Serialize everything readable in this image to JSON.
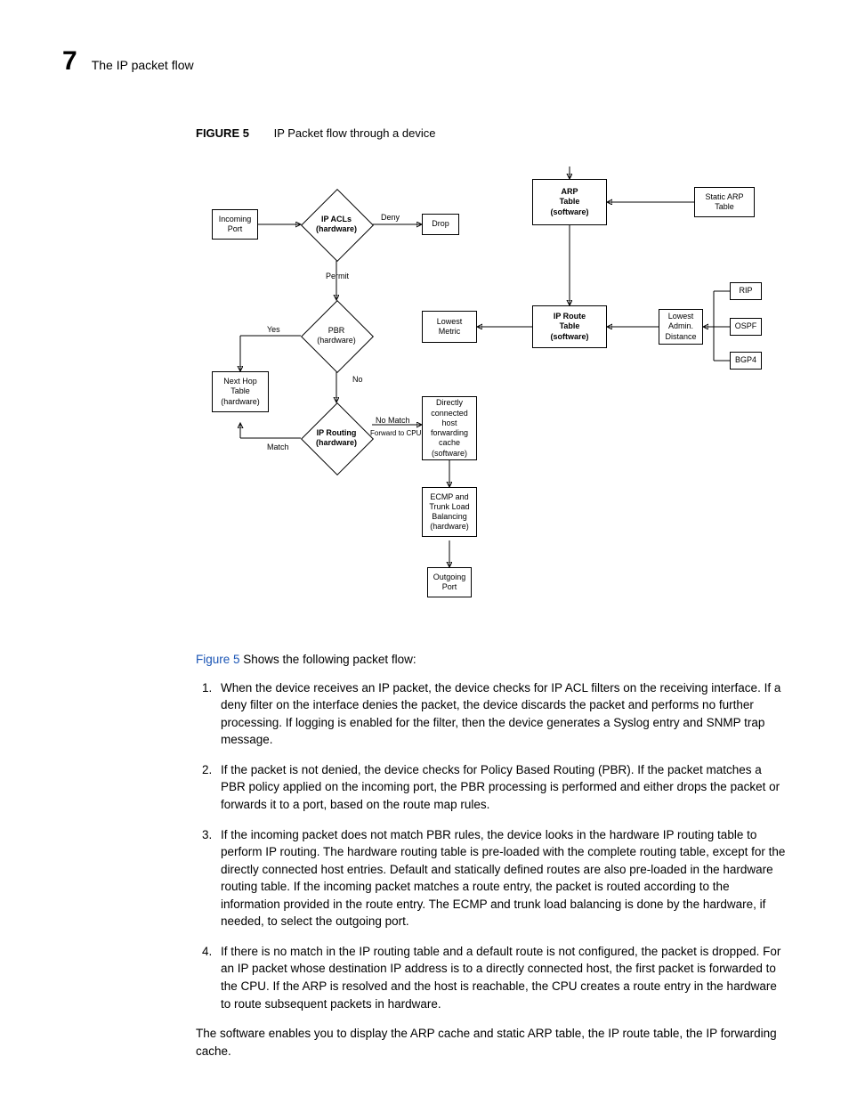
{
  "header": {
    "chapter_number": "7",
    "chapter_title": "The IP packet flow"
  },
  "figure": {
    "label": "FIGURE 5",
    "title": "IP Packet flow through a device"
  },
  "flow": {
    "incoming_port": "Incoming\nPort",
    "ip_acls": "IP ACLs\n(hardware)",
    "deny": "Deny",
    "drop": "Drop",
    "permit": "Permit",
    "pbr": "PBR\n(hardware)",
    "yes": "Yes",
    "no": "No",
    "next_hop": "Next Hop\nTable\n(hardware)",
    "ip_routing": "IP Routing\n(hardware)",
    "match": "Match",
    "no_match": "No Match",
    "forward_cpu": "Forward to CPU",
    "lowest_metric": "Lowest\nMetric",
    "ip_route_table": "IP Route\nTable\n(software)",
    "lowest_admin": "Lowest\nAdmin.\nDistance",
    "direct_host": "Directly\nconnected\nhost\nforwarding\ncache\n(software)",
    "ecmp": "ECMP and\nTrunk Load\nBalancing\n(hardware)",
    "outgoing_port": "Outgoing\nPort",
    "arp_table": "ARP\nTable\n(software)",
    "static_arp": "Static ARP\nTable",
    "rip": "RIP",
    "ospf": "OSPF",
    "bgp4": "BGP4"
  },
  "body": {
    "intro_link": "Figure 5",
    "intro_rest": " Shows the following packet flow:",
    "items": [
      "When the device receives an IP packet, the device checks for IP ACL filters on the receiving interface. If a deny filter on the interface denies the packet, the device discards the packet and performs no further processing. If logging is enabled for the filter, then the device generates a Syslog entry and SNMP trap message.",
      "If the packet is not denied, the device checks for Policy Based Routing (PBR). If the packet matches a PBR policy applied on the incoming port, the PBR processing is performed and either drops the packet or forwards it to a port, based on the route map rules.",
      "If the incoming packet does not match PBR rules, the device looks in the hardware IP routing table to perform IP routing. The hardware routing table is pre-loaded with the complete routing table, except for the directly connected host entries. Default and statically defined routes are also pre-loaded in the hardware routing table. If the incoming packet matches a route entry, the packet is routed according to the information provided in the route entry. The ECMP and trunk load balancing is done by the hardware, if needed, to select the outgoing port.",
      "If there is no match in the IP routing table and a default route is not configured, the packet is dropped. For an IP packet whose destination IP address is to a directly connected host, the first packet is forwarded to the CPU. If the ARP is resolved and the host is reachable, the CPU creates a route entry in the hardware to route subsequent packets in hardware."
    ],
    "after": "The software enables you to display the ARP cache and static ARP table, the IP route table, the IP forwarding cache."
  }
}
